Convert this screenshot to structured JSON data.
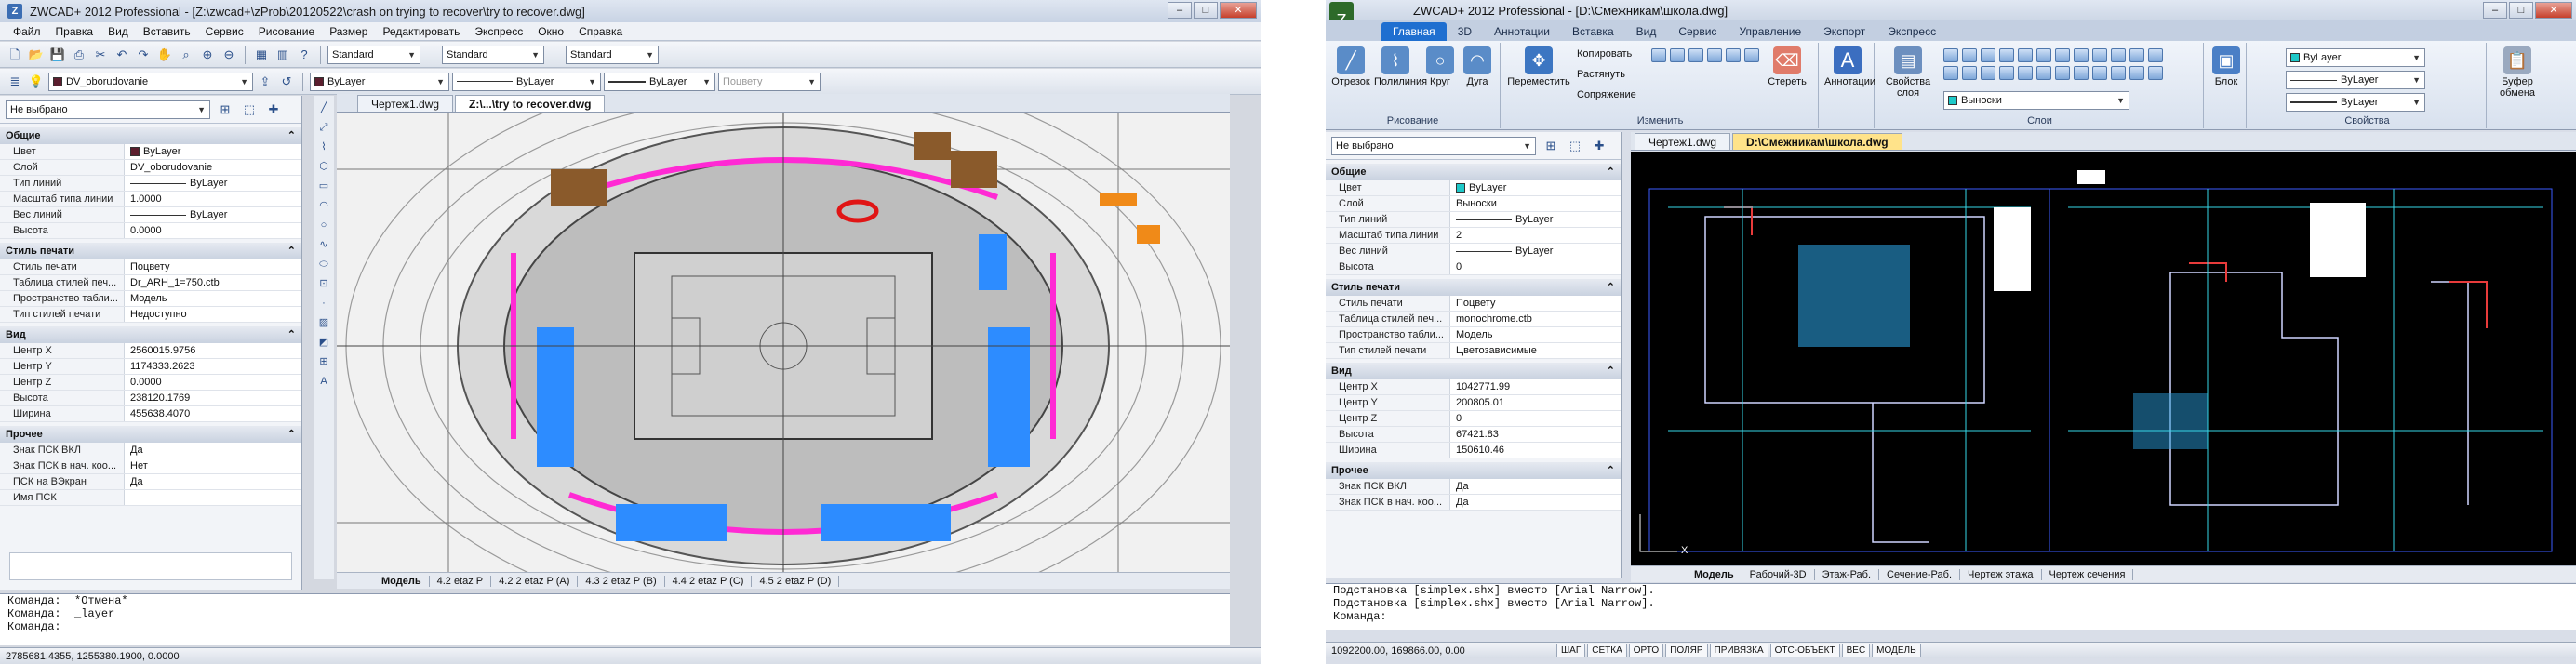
{
  "left": {
    "title": "ZWCAD+ 2012 Professional - [Z:\\zwcad+\\zProb\\20120522\\crash on trying to recover\\try to recover.dwg]",
    "menu": [
      "Файл",
      "Правка",
      "Вид",
      "Вставить",
      "Сервис",
      "Рисование",
      "Размер",
      "Редактировать",
      "Экспресс",
      "Окно",
      "Справка"
    ],
    "styles": [
      "Standard",
      "Standard",
      "Standard"
    ],
    "layer_combo": "DV_oborudovanie",
    "bylayer": [
      "ByLayer",
      "ByLayer",
      "ByLayer"
    ],
    "plot_style": "Поцвету",
    "selection": "Не выбрано",
    "sections": {
      "general": {
        "title": "Общие",
        "rows": [
          {
            "k": "Цвет",
            "v": "ByLayer"
          },
          {
            "k": "Слой",
            "v": "DV_oborudovanie"
          },
          {
            "k": "Тип линий",
            "v": "ByLayer"
          },
          {
            "k": "Масштаб типа линии",
            "v": "1.0000"
          },
          {
            "k": "Вес линий",
            "v": "ByLayer"
          },
          {
            "k": "Высота",
            "v": "0.0000"
          }
        ]
      },
      "plot": {
        "title": "Стиль печати",
        "rows": [
          {
            "k": "Стиль печати",
            "v": "Поцвету"
          },
          {
            "k": "Таблица стилей печ...",
            "v": "Dr_ARH_1=750.ctb"
          },
          {
            "k": "Пространство табли...",
            "v": "Модель"
          },
          {
            "k": "Тип стилей печати",
            "v": "Недоступно"
          }
        ]
      },
      "view": {
        "title": "Вид",
        "rows": [
          {
            "k": "Центр X",
            "v": "2560015.9756"
          },
          {
            "k": "Центр Y",
            "v": "1174333.2623"
          },
          {
            "k": "Центр Z",
            "v": "0.0000"
          },
          {
            "k": "Высота",
            "v": "238120.1769"
          },
          {
            "k": "Ширина",
            "v": "455638.4070"
          }
        ]
      },
      "misc": {
        "title": "Прочее",
        "rows": [
          {
            "k": "Знак ПСК ВКЛ",
            "v": "Да"
          },
          {
            "k": "Знак ПСК в нач. коо...",
            "v": "Нет"
          },
          {
            "k": "ПСК на ВЭкран",
            "v": "Да"
          },
          {
            "k": "Имя ПСК",
            "v": ""
          }
        ]
      }
    },
    "doc_tabs": [
      "Чертеж1.dwg",
      "Z:\\...\\try to recover.dwg"
    ],
    "layout_tabs": [
      "Модель",
      "4.2 etaz P",
      "4.2 2 etaz P (A)",
      "4.3 2 etaz P (B)",
      "4.4 2 etaz P (C)",
      "4.5 2 etaz P (D)"
    ],
    "command_lines": [
      "Команда:  *Отмена*",
      "Команда:  _layer",
      "Команда:"
    ],
    "coords": "2785681.4355, 1255380.1900, 0.0000"
  },
  "right": {
    "title": "ZWCAD+ 2012 Professional - [D:\\Смежникам\\школа.dwg]",
    "ribbon_tabs": [
      "Главная",
      "3D",
      "Аннотации",
      "Вставка",
      "Вид",
      "Сервис",
      "Управление",
      "Экспорт",
      "Экспресс"
    ],
    "draw_buttons": [
      "Отрезок",
      "Полилиния",
      "Круг",
      "Дуга"
    ],
    "modify": {
      "move": "Переместить",
      "copy": "Копировать",
      "stretch": "Растянуть",
      "fillet": "Сопряжение",
      "erase": "Стереть"
    },
    "annot": "Аннотации",
    "layer_props": "Свойства слоя",
    "layer_name": "Выноски",
    "block": "Блок",
    "buffer": "Буфер обмена",
    "props_bylayer": [
      "ByLayer",
      "ByLayer",
      "ByLayer"
    ],
    "groups": {
      "draw": "Рисование",
      "modify": "Изменить",
      "layers": "Слои",
      "props": "Свойства"
    },
    "selection": "Не выбрано",
    "sections": {
      "general": {
        "title": "Общие",
        "rows": [
          {
            "k": "Цвет",
            "v": "ByLayer"
          },
          {
            "k": "Слой",
            "v": "Выноски"
          },
          {
            "k": "Тип линий",
            "v": "ByLayer"
          },
          {
            "k": "Масштаб типа линии",
            "v": "2"
          },
          {
            "k": "Вес линий",
            "v": "ByLayer"
          },
          {
            "k": "Высота",
            "v": "0"
          }
        ]
      },
      "plot": {
        "title": "Стиль печати",
        "rows": [
          {
            "k": "Стиль печати",
            "v": "Поцвету"
          },
          {
            "k": "Таблица стилей печ...",
            "v": "monochrome.ctb"
          },
          {
            "k": "Пространство табли...",
            "v": "Модель"
          },
          {
            "k": "Тип стилей печати",
            "v": "Цветозависимые"
          }
        ]
      },
      "view": {
        "title": "Вид",
        "rows": [
          {
            "k": "Центр X",
            "v": "1042771.99"
          },
          {
            "k": "Центр Y",
            "v": "200805.01"
          },
          {
            "k": "Центр Z",
            "v": "0"
          },
          {
            "k": "Высота",
            "v": "67421.83"
          },
          {
            "k": "Ширина",
            "v": "150610.46"
          }
        ]
      },
      "misc": {
        "title": "Прочее",
        "rows": [
          {
            "k": "Знак ПСК ВКЛ",
            "v": "Да"
          },
          {
            "k": "Знак ПСК в нач. коо...",
            "v": "Да"
          }
        ]
      }
    },
    "doc_tabs": [
      "Чертеж1.dwg",
      "D:\\Смежникам\\школа.dwg"
    ],
    "layout_tabs": [
      "Модель",
      "Рабочий-3D",
      "Этаж-Раб.",
      "Сечение-Раб.",
      "Чертеж этажа",
      "Чертеж сечения"
    ],
    "command_lines": [
      "Подстановка [simplex.shx] вместо [Arial Narrow].",
      "Подстановка [simplex.shx] вместо [Arial Narrow].",
      "Команда:"
    ],
    "coords": "1092200.00, 169866.00, 0.00",
    "status_buttons": [
      "ШАГ",
      "СЕТКА",
      "ОРТО",
      "ПОЛЯР",
      "ПРИВЯЗКА",
      "ОТС-ОБЪЕКТ",
      "ВЕС",
      "МОДЕЛЬ"
    ]
  }
}
